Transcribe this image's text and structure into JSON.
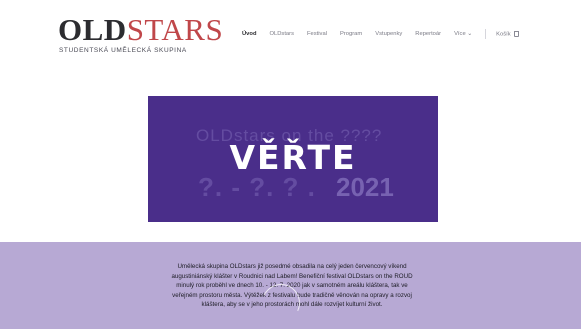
{
  "logo": {
    "part1": "OLD",
    "part2": "STARS",
    "subtitle": "STUDENTSKÁ UMĚLECKÁ SKUPINA"
  },
  "nav": {
    "items": [
      {
        "label": "Úvod",
        "active": true
      },
      {
        "label": "OLDstars",
        "active": false
      },
      {
        "label": "Festival",
        "active": false
      },
      {
        "label": "Program",
        "active": false
      },
      {
        "label": "Vstupenky",
        "active": false
      },
      {
        "label": "Repertoár",
        "active": false
      },
      {
        "label": "Více ⌄",
        "active": false
      }
    ],
    "cart_label": "Košík"
  },
  "hero": {
    "title": "VĚŘTE",
    "ghost_line1": "OLDstars on the ????",
    "ghost_line2": "?. - ?. ? .",
    "ghost_year": "2021"
  },
  "intro": {
    "line1": "Umělecká skupina OLDstars již posedmé obsadila na celý jeden červencový víkend",
    "line2": "augustiniánský klášter v Roudnici nad Labem! Benefiční festival OLDstars on the ROUD",
    "line3": "minulý rok proběhl ve dnech 10. - 12. 7. 2020 jak v samotném areálu kláštera, tak ve",
    "line4": "veřejném prostoru města. Výtěžek z festivalu bude tradičně věnován na opravy a rozvoj",
    "line5": "kláštera, aby se v jeho prostorách mohl dále rozvíjet kulturní život."
  },
  "colors": {
    "hero_bg": "#4a2e8a",
    "section_bg": "#b7a9d4",
    "logo_accent": "#c0474a"
  }
}
